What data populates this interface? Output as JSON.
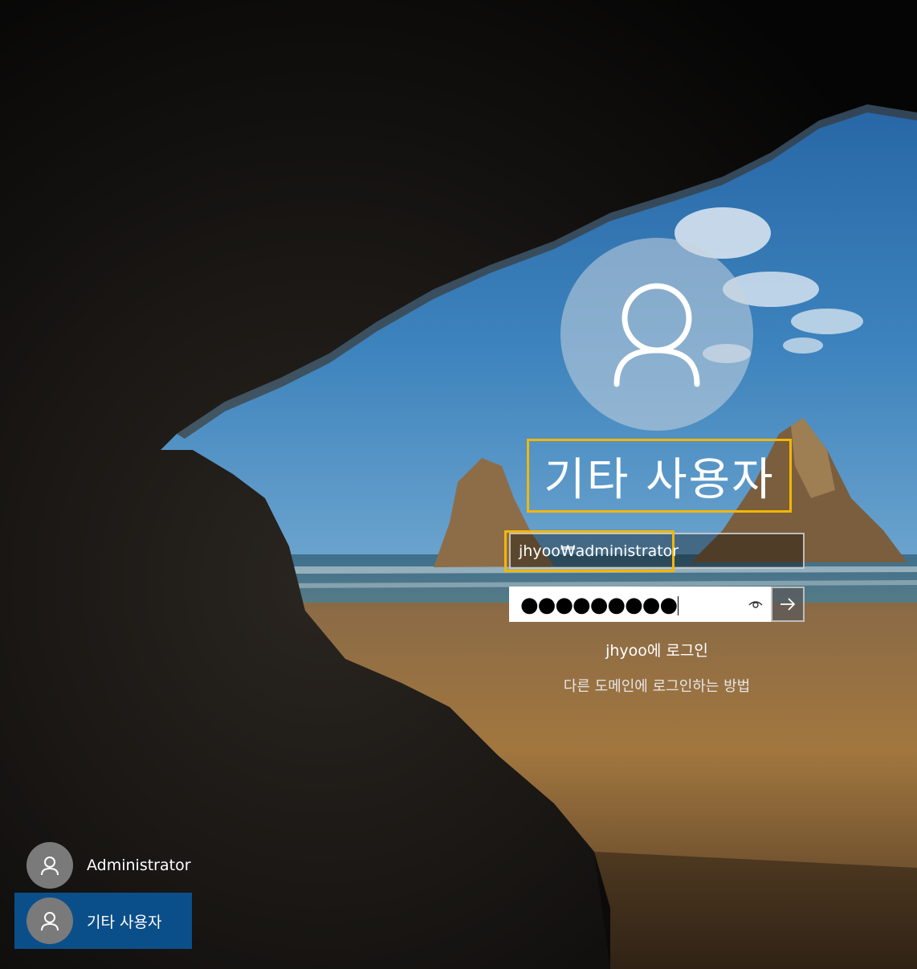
{
  "login": {
    "title": "기타 사용자",
    "username_value": "jhyoo₩administrator",
    "password_mask": "●●●●●●●●●",
    "signin_to": "jhyoo에 로그인",
    "other_domain_link": "다른 도메인에 로그인하는 방법"
  },
  "user_list": {
    "items": [
      {
        "label": "Administrator",
        "selected": false
      },
      {
        "label": "기타 사용자",
        "selected": true
      }
    ]
  },
  "colors": {
    "highlight": "#f2b705",
    "selected_tile": "#0b4f8a",
    "sky": "#2a6aa8",
    "sand": "#b07a3a"
  },
  "icons": {
    "large_avatar": "user-icon",
    "reveal": "eye-icon",
    "submit": "arrow-right-icon",
    "tile_avatar": "user-icon"
  }
}
